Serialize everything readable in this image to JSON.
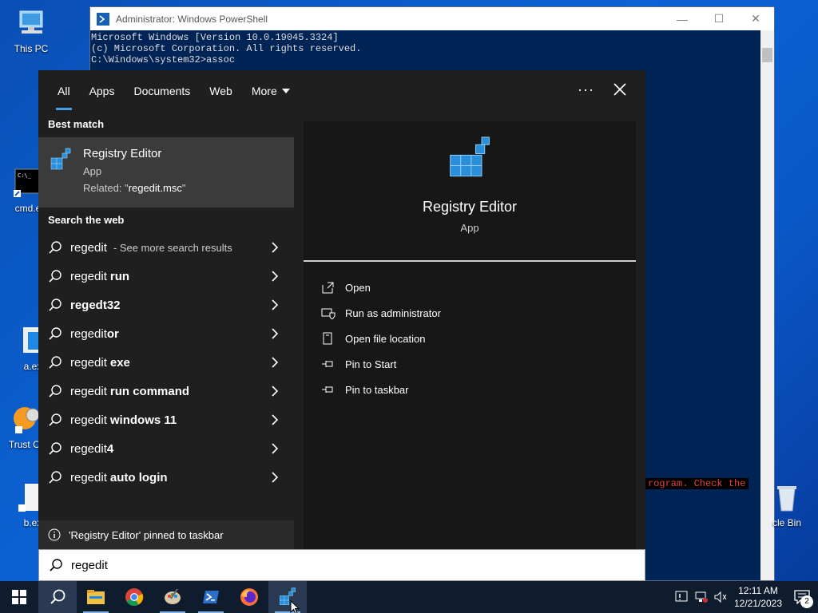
{
  "desktop": {
    "icons": [
      {
        "label": "This PC"
      },
      {
        "label": "cmd.e"
      },
      {
        "label": "a.ex"
      },
      {
        "label": "Trust Cle"
      },
      {
        "label": "b.ex"
      },
      {
        "label": "cle Bin"
      }
    ]
  },
  "powershell": {
    "title": "Administrator: Windows PowerShell",
    "lines": [
      "Microsoft Windows [Version 10.0.19045.3324]",
      "(c) Microsoft Corporation. All rights reserved.",
      "",
      "C:\\Windows\\system32>assoc"
    ],
    "error_fragment": "rogram. Check the"
  },
  "search": {
    "tabs": [
      {
        "label": "All",
        "active": true
      },
      {
        "label": "Apps"
      },
      {
        "label": "Documents"
      },
      {
        "label": "Web"
      },
      {
        "label": "More"
      }
    ],
    "best_match_heading": "Best match",
    "best_match": {
      "title": "Registry Editor",
      "type": "App",
      "related_prefix": "Related: \"",
      "related_value": "regedit.msc",
      "related_suffix": "\""
    },
    "web_heading": "Search the web",
    "web_items": [
      {
        "base": "regedit",
        "bold": "",
        "more": "- See more search results"
      },
      {
        "base": "regedit",
        "bold": "run",
        "more": ""
      },
      {
        "base": "",
        "bold": "regedt32",
        "more": ""
      },
      {
        "base": "regedit",
        "bold": "or",
        "more": ""
      },
      {
        "base": "regedit",
        "bold": "exe",
        "more": ""
      },
      {
        "base": "regedit",
        "bold": "run command",
        "more": ""
      },
      {
        "base": "regedit",
        "bold": "windows 11",
        "more": ""
      },
      {
        "base": "regedit",
        "bold": "4",
        "more": ""
      },
      {
        "base": "regedit",
        "bold": "auto login",
        "more": ""
      }
    ],
    "pinned_message": "'Registry Editor' pinned to taskbar",
    "preview": {
      "title": "Registry Editor",
      "type": "App",
      "actions": [
        {
          "label": "Open",
          "icon": "open-icon"
        },
        {
          "label": "Run as administrator",
          "icon": "shield-icon"
        },
        {
          "label": "Open file location",
          "icon": "file-location-icon"
        },
        {
          "label": "Pin to Start",
          "icon": "pin-icon"
        },
        {
          "label": "Pin to taskbar",
          "icon": "pin-icon"
        }
      ]
    },
    "query": "regedit"
  },
  "taskbar": {
    "time": "12:11 AM",
    "date": "12/21/2023",
    "notification_count": "2"
  },
  "colors": {
    "accent": "#4aa0e8",
    "panel": "#1f1f1f",
    "selected": "#3b3b3b",
    "taskbar": "#0f1c2e"
  }
}
